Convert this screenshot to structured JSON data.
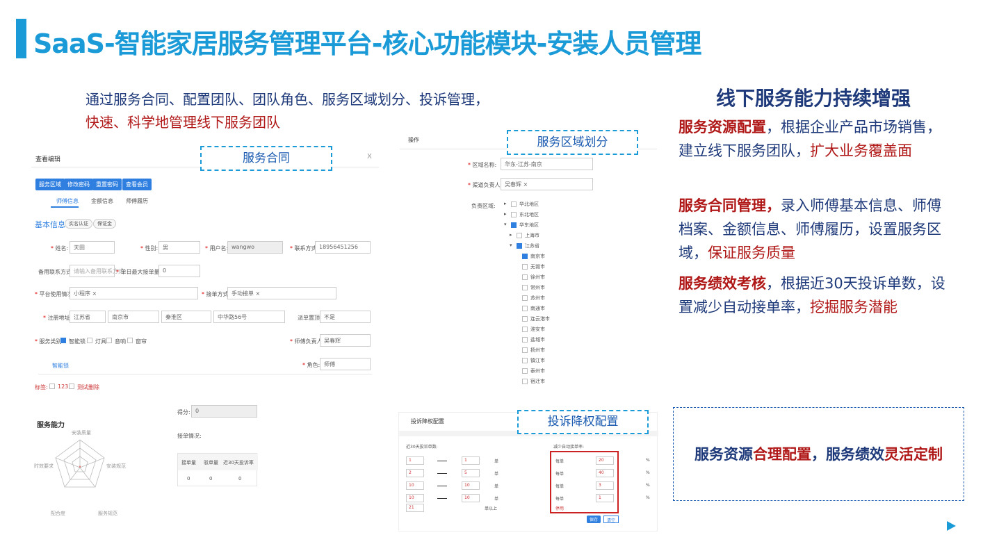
{
  "header": {
    "title": "SaaS-智能家居服务管理平台-核心功能模块-安装人员管理"
  },
  "intro": {
    "line1": "通过服务合同、配置团队、团队角色、服务区域划分、投诉管理，",
    "line2": "快速、科学地管理线下服务团队"
  },
  "right": {
    "heading": "线下服务能力持续增强",
    "p1": {
      "bold": "服务资源配置",
      "text": "，根据企业产品市场销售，建立线下服务团队，",
      "red": "扩大业务覆盖面"
    },
    "p2": {
      "bold": "服务合同管理，",
      "text": "录入师傅基本信息、师傅档案、金额信息、师傅履历，设置服务区域，",
      "red": "保证服务质量"
    },
    "p3": {
      "bold": "服务绩效考核",
      "text": "，根据近30天投诉单数，设置减少自动接单率，",
      "red": "挖掘服务潜能"
    }
  },
  "callouts": {
    "contract": "服务合同",
    "area": "服务区域划分",
    "complaint": "投诉降权配置"
  },
  "summary": {
    "a": "服务资源",
    "b": "合理配置",
    "c": "，服务绩效",
    "d": "灵活定制"
  },
  "contract_form": {
    "dialog_title": "查看编辑",
    "close": "X",
    "buttons": [
      "服务区域",
      "修改密码",
      "重置密码",
      "查看会员"
    ],
    "tabs": [
      "师傅信息",
      "金额信息",
      "师傅履历"
    ],
    "basic_info": "基本信息：",
    "badges": [
      "实名认证",
      "保证金"
    ],
    "name_label": "姓名:",
    "name_value": "天田",
    "gender_label": "性别:",
    "gender_value": "男",
    "user_label": "用户名:",
    "user_value": "wangwo",
    "phone_label": "联系方式:",
    "phone_value": "18956451256",
    "backup_label": "备用联系方式:",
    "backup_placeholder": "请输入备用联系方式",
    "max_label": "单日最大接单量:",
    "max_value": "0",
    "platform_label": "平台使用情况:",
    "platform_value": "小程序 ×",
    "mode_label": "接单方式:",
    "mode_value": "手动接单 ×",
    "addr_label": "注册地址:",
    "province": "江苏省",
    "city": "南京市",
    "district": "秦淮区",
    "street": "中华路56号",
    "top_label": "派单置顶:",
    "top_value": "不是",
    "category_label": "服务类别:",
    "categories": [
      "智能锁",
      "灯具",
      "音响",
      "窗帘"
    ],
    "manager_label": "师傅负责人:",
    "manager_value": "吴春辉",
    "subtab": "智能锁",
    "role_label": "角色:",
    "role_value": "师傅",
    "tags_label": "标签:",
    "tags": [
      "123",
      "测试删除"
    ],
    "ability_title": "服务能力",
    "radar_labels": [
      "安装质量",
      "安装规范",
      "服务规范",
      "配合度",
      "时效要求"
    ],
    "score_label": "得分:",
    "score_value": "0",
    "order_label": "接单情况:",
    "table_head": [
      "接单量",
      "驳单量",
      "近30天投诉率"
    ],
    "table_row": [
      "0",
      "0",
      "0"
    ]
  },
  "area_form": {
    "op": "操作",
    "area_name_label": "区域名称:",
    "area_name_value": "华东-江苏-南京",
    "channel_label": "渠道负责人:",
    "channel_value": "吴春辉 ×",
    "region_label": "负责区域:",
    "tree": [
      "华北地区",
      "东北地区",
      "华东地区",
      "上海市",
      "江苏省",
      "南京市",
      "无锡市",
      "徐州市",
      "常州市",
      "苏州市",
      "南通市",
      "连云港市",
      "淮安市",
      "盐城市",
      "扬州市",
      "镇江市",
      "泰州市",
      "宿迁市"
    ]
  },
  "complaint_form": {
    "title": "投诉降权配置",
    "left_head": "近30天投诉单数:",
    "right_head": "减少自动接单率:",
    "rows": [
      [
        "1",
        "1",
        "单",
        "每单",
        "20",
        "%"
      ],
      [
        "2",
        "5",
        "单",
        "每单",
        "40",
        "%"
      ],
      [
        "10",
        "10",
        "单",
        "每单",
        "3",
        "%"
      ],
      [
        "10",
        "10",
        "单",
        "每单",
        "1",
        "%"
      ]
    ],
    "last_value": "21",
    "last_unit": "单以上",
    "stop": "停用",
    "save": "保存",
    "clear": "清空"
  }
}
